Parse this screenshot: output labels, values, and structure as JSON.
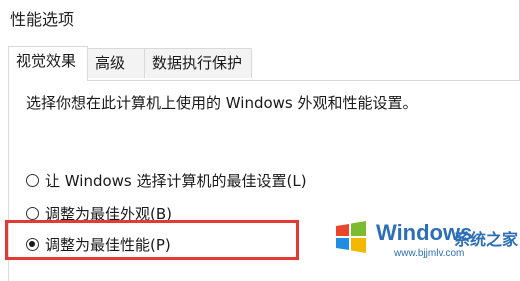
{
  "window": {
    "title": "性能选项"
  },
  "tabs": [
    {
      "label": "视觉效果",
      "active": true
    },
    {
      "label": "高级",
      "active": false
    },
    {
      "label": "数据执行保护",
      "active": false
    }
  ],
  "panel": {
    "description": "选择你想在此计算机上使用的 Windows 外观和性能设置。",
    "options": [
      {
        "label": "让 Windows 选择计算机的最佳设置(L)",
        "checked": false
      },
      {
        "label": "调整为最佳外观(B)",
        "checked": false
      },
      {
        "label": "调整为最佳性能(P)",
        "checked": true
      }
    ]
  },
  "watermark": {
    "brand": "Windows",
    "sub": "系统之家",
    "url": "www.bjjmlv.com"
  },
  "colors": {
    "highlight": "#e53935",
    "watermark": "#2c6fb7"
  }
}
